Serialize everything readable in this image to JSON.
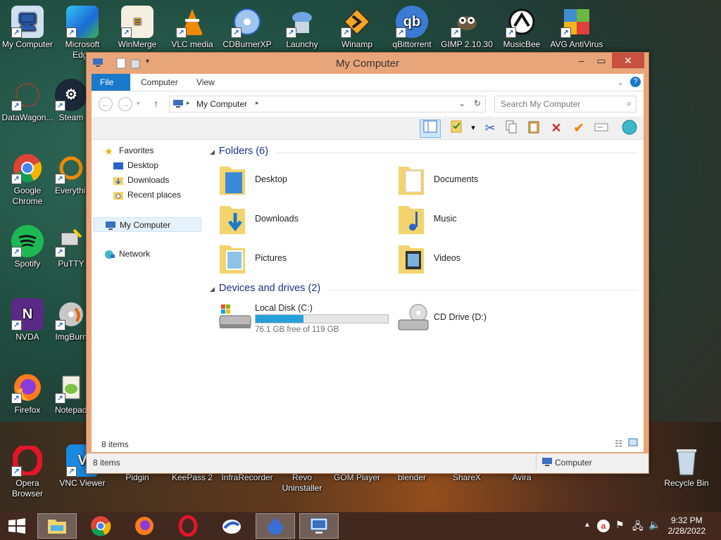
{
  "desktop": {
    "icons": [
      {
        "label": "My Computer"
      },
      {
        "label": "Microsoft Edge"
      },
      {
        "label": "WinMerge"
      },
      {
        "label": "VLC media"
      },
      {
        "label": "CDBurnerXP"
      },
      {
        "label": "Launchy"
      },
      {
        "label": "Winamp"
      },
      {
        "label": "qBittorrent"
      },
      {
        "label": "GIMP 2.10.30"
      },
      {
        "label": "MusicBee"
      },
      {
        "label": "AVG AntiVirus"
      },
      {
        "label": "DataWagon..."
      },
      {
        "label": "Steam"
      },
      {
        "label": "Google Chrome"
      },
      {
        "label": "Everything"
      },
      {
        "label": "Spotify"
      },
      {
        "label": "PuTTY"
      },
      {
        "label": "NVDA"
      },
      {
        "label": "ImgBurn"
      },
      {
        "label": "Firefox"
      },
      {
        "label": "Notepad++"
      },
      {
        "label": "Opera Browser"
      },
      {
        "label": "VNC Viewer"
      },
      {
        "label": "Pidgin"
      },
      {
        "label": "KeePass 2"
      },
      {
        "label": "InfraRecorder"
      },
      {
        "label": "Revo Uninstaller"
      },
      {
        "label": "GOM Player"
      },
      {
        "label": "blender"
      },
      {
        "label": "ShareX"
      },
      {
        "label": "Avira"
      },
      {
        "label": "Recycle Bin"
      }
    ]
  },
  "window": {
    "title": "My Computer",
    "tabs": [
      "File",
      "Computer",
      "View"
    ],
    "address": "My Computer",
    "search_placeholder": "Search My Computer",
    "nav": {
      "favorites": "Favorites",
      "fav_items": [
        "Desktop",
        "Downloads",
        "Recent places"
      ],
      "computer": "My Computer",
      "network": "Network"
    },
    "folders_header": "Folders (6)",
    "folders": [
      "Desktop",
      "Documents",
      "Downloads",
      "Music",
      "Pictures",
      "Videos"
    ],
    "drives_header": "Devices and drives (2)",
    "drives": [
      {
        "name": "Local Disk (C:)",
        "free": "76.1 GB free of 119 GB",
        "used_fraction": 0.36
      },
      {
        "name": "CD Drive (D:)"
      }
    ],
    "items_count": "8 items",
    "status_count": "8 items",
    "status_location": "Computer"
  },
  "taskbar": {
    "time": "9:32 PM",
    "date": "2/28/2022"
  },
  "colors": {
    "accent": "#1979ca",
    "window_frame": "#e9a57a",
    "close": "#c7503f",
    "folder": "#f3d36b",
    "link": "#1e3287"
  }
}
